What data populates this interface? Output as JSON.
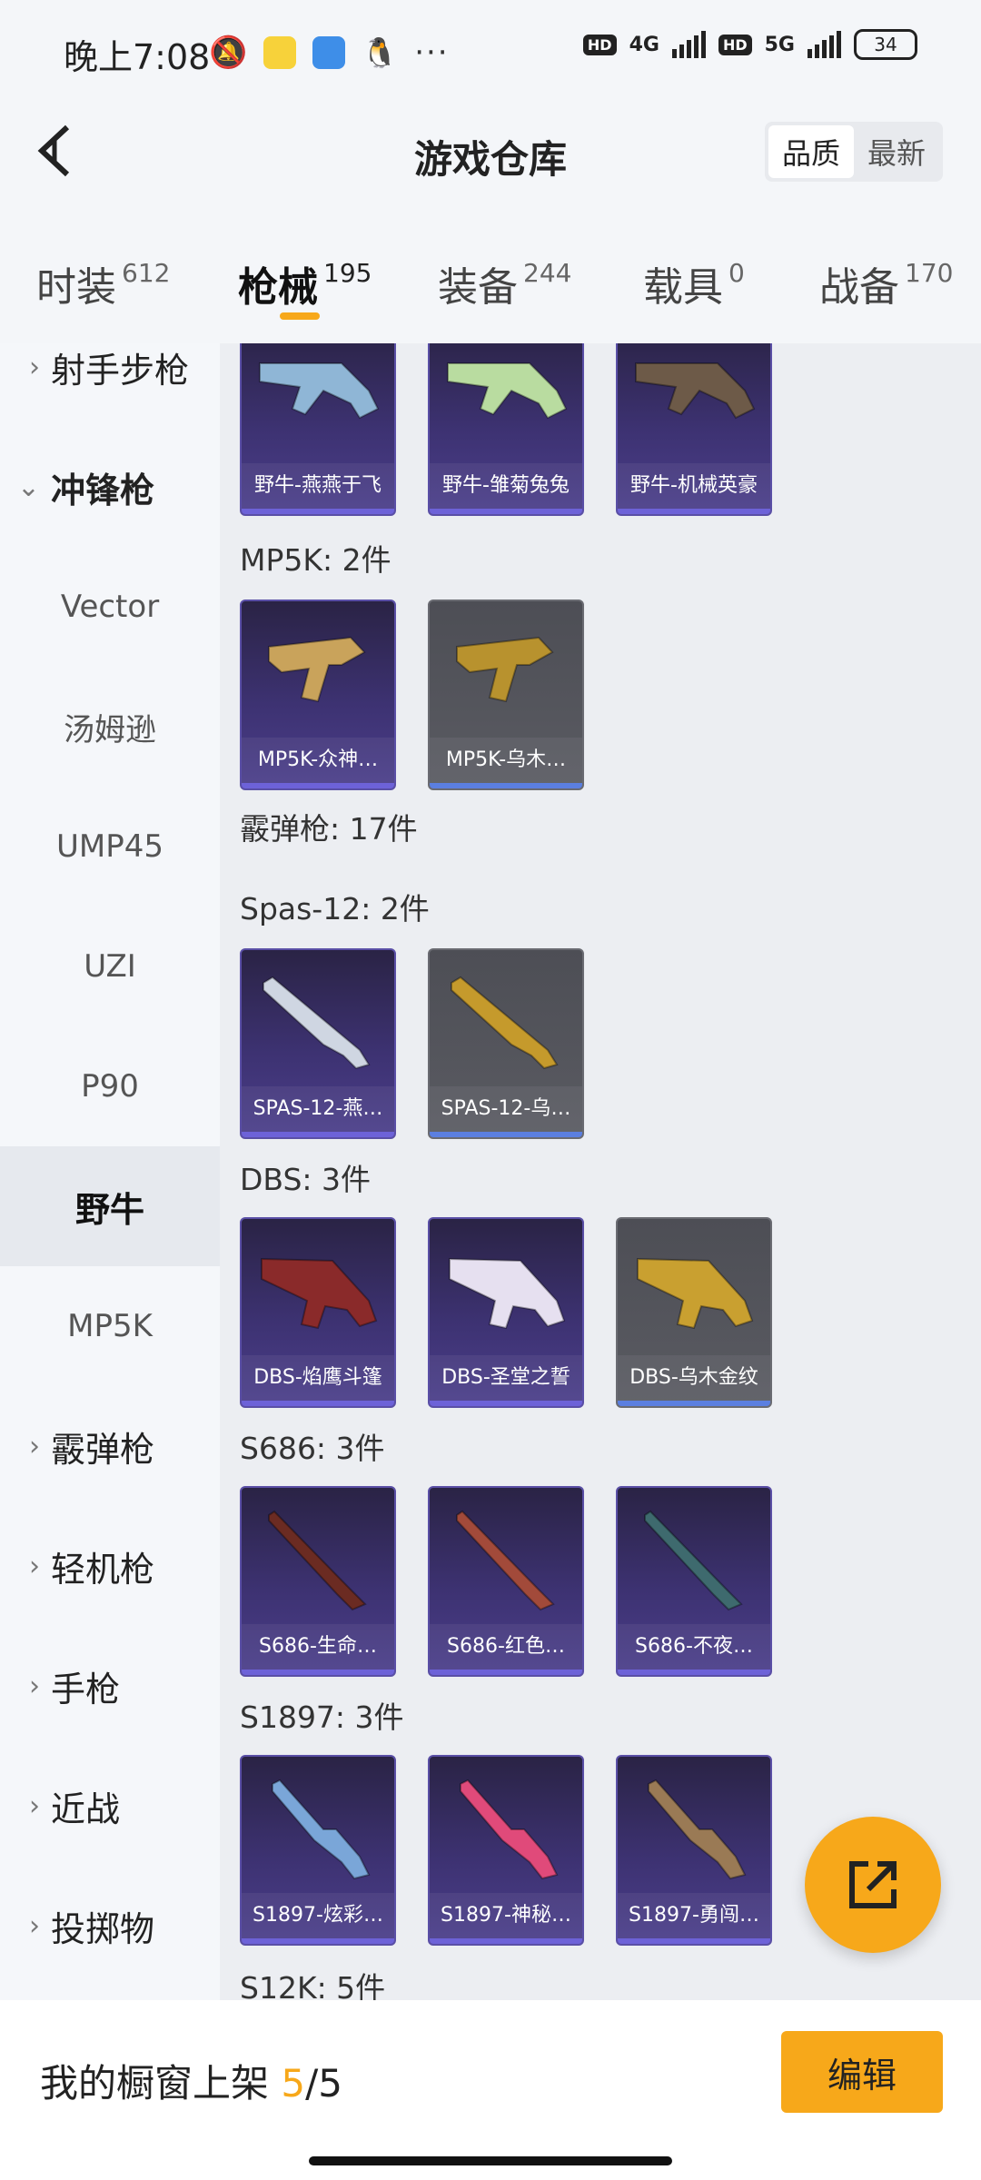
{
  "status": {
    "time": "晚上7:08",
    "hd": "HD",
    "net1": "4G",
    "net2": "5G",
    "battery": "34"
  },
  "header": {
    "title": "游戏仓库",
    "sort_options": [
      "品质",
      "最新"
    ],
    "active_sort": "品质"
  },
  "tabs": [
    {
      "label": "时装",
      "count": "612"
    },
    {
      "label": "枪械",
      "count": "195"
    },
    {
      "label": "装备",
      "count": "244"
    },
    {
      "label": "载具",
      "count": "0"
    },
    {
      "label": "战备",
      "count": "170"
    }
  ],
  "active_tab": "枪械",
  "sidebar": {
    "items": [
      {
        "label": "射手步枪",
        "type": "category"
      },
      {
        "label": "冲锋枪",
        "type": "category-open"
      },
      {
        "label": "Vector",
        "type": "sub"
      },
      {
        "label": "汤姆逊",
        "type": "sub"
      },
      {
        "label": "UMP45",
        "type": "sub"
      },
      {
        "label": "UZI",
        "type": "sub"
      },
      {
        "label": "P90",
        "type": "sub"
      },
      {
        "label": "野牛",
        "type": "sub-selected"
      },
      {
        "label": "MP5K",
        "type": "sub"
      },
      {
        "label": "霰弹枪",
        "type": "category"
      },
      {
        "label": "轻机枪",
        "type": "category"
      },
      {
        "label": "手枪",
        "type": "category"
      },
      {
        "label": "近战",
        "type": "category"
      },
      {
        "label": "投掷物",
        "type": "category"
      }
    ]
  },
  "content": {
    "groups": [
      {
        "title": "",
        "items": [
          {
            "name": "野牛-燕燕于飞",
            "style": "purple",
            "gun_color": "#8fb6d6"
          },
          {
            "name": "野牛-雏菊兔兔",
            "style": "purple",
            "gun_color": "#b9dca0"
          },
          {
            "name": "野牛-机械英豪",
            "style": "purple",
            "gun_color": "#6d5a48"
          }
        ]
      },
      {
        "title": "MP5K: 2件",
        "items": [
          {
            "name": "MP5K-众神…",
            "style": "purple",
            "gun_color": "#c9a35b"
          },
          {
            "name": "MP5K-乌木…",
            "style": "grey",
            "gun_color": "#b8922e"
          }
        ]
      },
      {
        "title": "霰弹枪: 17件",
        "items": []
      },
      {
        "title": "Spas-12: 2件",
        "items": [
          {
            "name": "SPAS-12-燕…",
            "style": "purple",
            "gun_color": "#cfd6e2"
          },
          {
            "name": "SPAS-12-乌…",
            "style": "grey",
            "gun_color": "#c59a2c"
          }
        ]
      },
      {
        "title": "DBS: 3件",
        "items": [
          {
            "name": "DBS-焰鹰斗篷",
            "style": "purple",
            "gun_color": "#8a2a2a"
          },
          {
            "name": "DBS-圣堂之誓",
            "style": "purple",
            "gun_color": "#e6e0f0"
          },
          {
            "name": "DBS-乌木金纹",
            "style": "grey",
            "gun_color": "#c9a030"
          }
        ]
      },
      {
        "title": "S686: 3件",
        "items": [
          {
            "name": "S686-生命…",
            "style": "purple",
            "gun_color": "#6b2b22"
          },
          {
            "name": "S686-红色…",
            "style": "purple",
            "gun_color": "#a24a3a"
          },
          {
            "name": "S686-不夜…",
            "style": "purple",
            "gun_color": "#3e6a6e"
          }
        ]
      },
      {
        "title": "S1897: 3件",
        "items": [
          {
            "name": "S1897-炫彩…",
            "style": "purple",
            "gun_color": "#7aa6d8"
          },
          {
            "name": "S1897-神秘…",
            "style": "purple",
            "gun_color": "#e04a7a"
          },
          {
            "name": "S1897-勇闯…",
            "style": "purple",
            "gun_color": "#9a7a55"
          }
        ]
      },
      {
        "title": "S12K: 5件",
        "items": []
      }
    ]
  },
  "bottom": {
    "shelf_label": "我的橱窗上架",
    "shelf_current": "5",
    "shelf_total": "/5",
    "edit_label": "编辑"
  },
  "colors": {
    "accent": "#f7a81a",
    "card_purple": "#3d3272",
    "card_grey": "#5a5b62"
  },
  "icons": {
    "back": "back-arrow-icon",
    "fab": "share-external-icon"
  }
}
